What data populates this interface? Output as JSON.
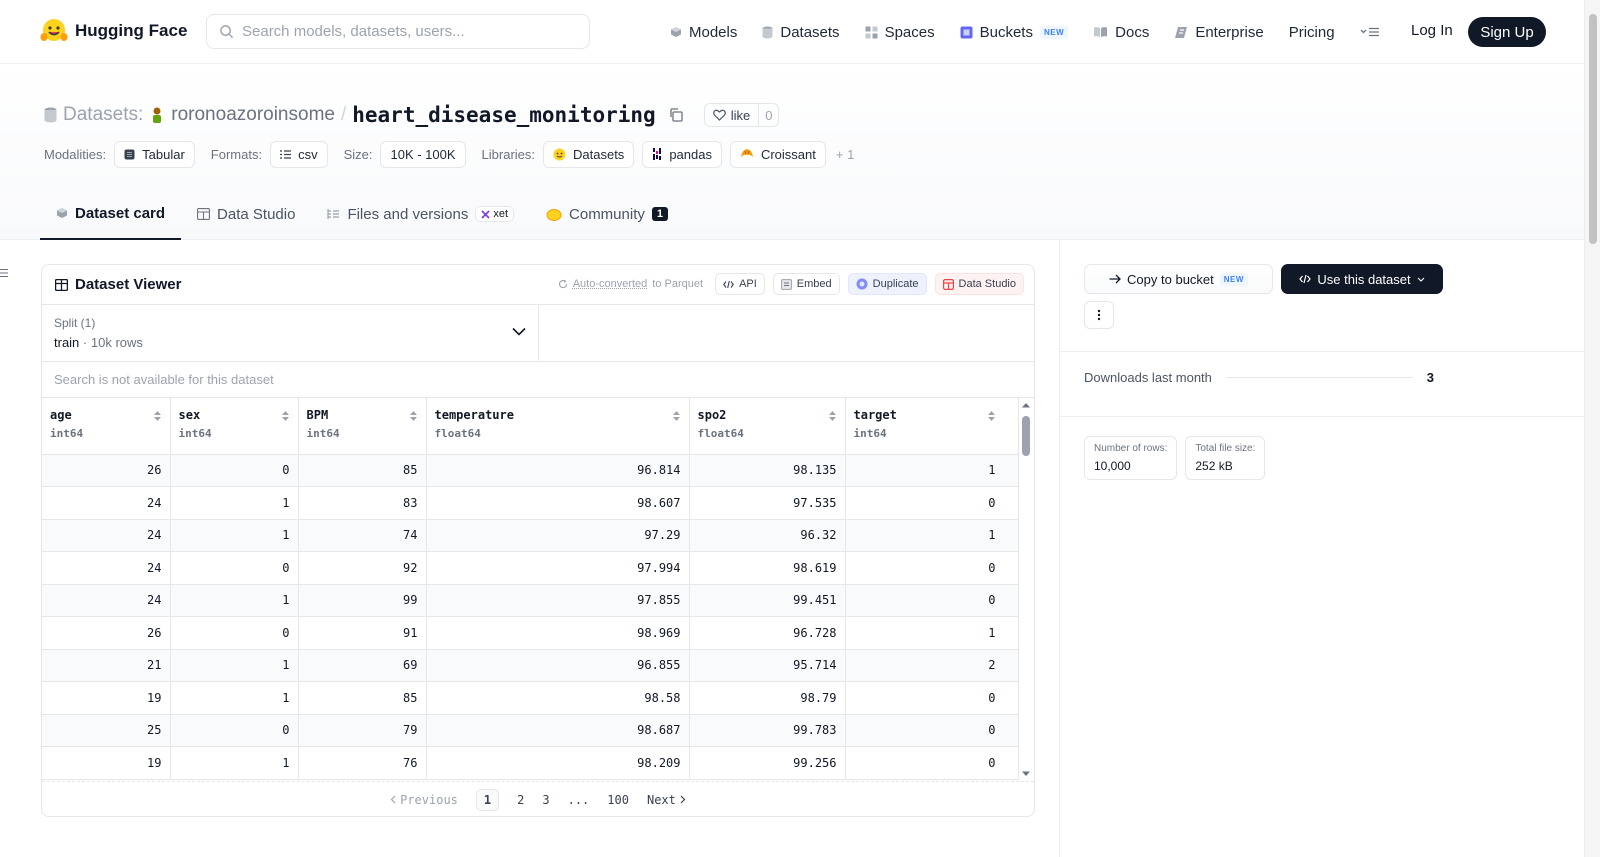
{
  "nav": {
    "brand": "Hugging Face",
    "search_placeholder": "Search models, datasets, users...",
    "links": [
      {
        "label": "Models",
        "icon": "cube-icon"
      },
      {
        "label": "Datasets",
        "icon": "database-icon"
      },
      {
        "label": "Spaces",
        "icon": "grid-icon"
      },
      {
        "label": "Buckets",
        "icon": "bucket-icon",
        "badge": "NEW"
      },
      {
        "label": "Docs",
        "icon": "book-icon"
      },
      {
        "label": "Enterprise",
        "icon": "enterprise-icon"
      },
      {
        "label": "Pricing"
      }
    ],
    "login": "Log In",
    "signup": "Sign Up"
  },
  "header": {
    "section": "Datasets:",
    "owner": "roronoazoroinsome",
    "slash": "/",
    "repo": "heart_disease_monitoring",
    "like_label": "like",
    "like_count": "0",
    "meta": {
      "modalities_label": "Modalities:",
      "modality": "Tabular",
      "formats_label": "Formats:",
      "format": "csv",
      "size_label": "Size:",
      "size": "10K - 100K",
      "libraries_label": "Libraries:",
      "libraries": [
        "Datasets",
        "pandas",
        "Croissant"
      ],
      "more": "+ 1"
    },
    "tabs": {
      "card": "Dataset card",
      "studio": "Data Studio",
      "files": "Files and versions",
      "xet": "xet",
      "community": "Community",
      "community_count": "1"
    }
  },
  "viewer": {
    "title": "Dataset Viewer",
    "auto_converted": "Auto-converted",
    "to_parquet": "to Parquet",
    "actions": {
      "api": "API",
      "embed": "Embed",
      "duplicate": "Duplicate",
      "data_studio": "Data Studio"
    },
    "split_label": "Split (1)",
    "split_value": "train",
    "split_dot": "·",
    "split_rows": "10k rows",
    "search_na": "Search is not available for this dataset",
    "columns": [
      {
        "name": "age",
        "type": "int64"
      },
      {
        "name": "sex",
        "type": "int64"
      },
      {
        "name": "BPM",
        "type": "int64"
      },
      {
        "name": "temperature",
        "type": "float64"
      },
      {
        "name": "spo2",
        "type": "float64"
      },
      {
        "name": "target",
        "type": "int64"
      }
    ],
    "rows": [
      [
        "26",
        "0",
        "85",
        "96.814",
        "98.135",
        "1"
      ],
      [
        "24",
        "1",
        "83",
        "98.607",
        "97.535",
        "0"
      ],
      [
        "24",
        "1",
        "74",
        "97.29",
        "96.32",
        "1"
      ],
      [
        "24",
        "0",
        "92",
        "97.994",
        "98.619",
        "0"
      ],
      [
        "24",
        "1",
        "99",
        "97.855",
        "99.451",
        "0"
      ],
      [
        "26",
        "0",
        "91",
        "98.969",
        "96.728",
        "1"
      ],
      [
        "21",
        "1",
        "69",
        "96.855",
        "95.714",
        "2"
      ],
      [
        "19",
        "1",
        "85",
        "98.58",
        "98.79",
        "0"
      ],
      [
        "25",
        "0",
        "79",
        "98.687",
        "99.783",
        "0"
      ],
      [
        "19",
        "1",
        "76",
        "98.209",
        "99.256",
        "0"
      ]
    ],
    "pager": {
      "prev": "Previous",
      "pages": [
        "1",
        "2",
        "3",
        "...",
        "100"
      ],
      "next": "Next"
    }
  },
  "side": {
    "copy_bucket": "Copy to bucket",
    "copy_badge": "NEW",
    "use_dataset": "Use this dataset",
    "downloads_label": "Downloads last month",
    "downloads_value": "3",
    "rows_label": "Number of rows:",
    "rows_value": "10,000",
    "size_label": "Total file size:",
    "size_value": "252 kB"
  }
}
